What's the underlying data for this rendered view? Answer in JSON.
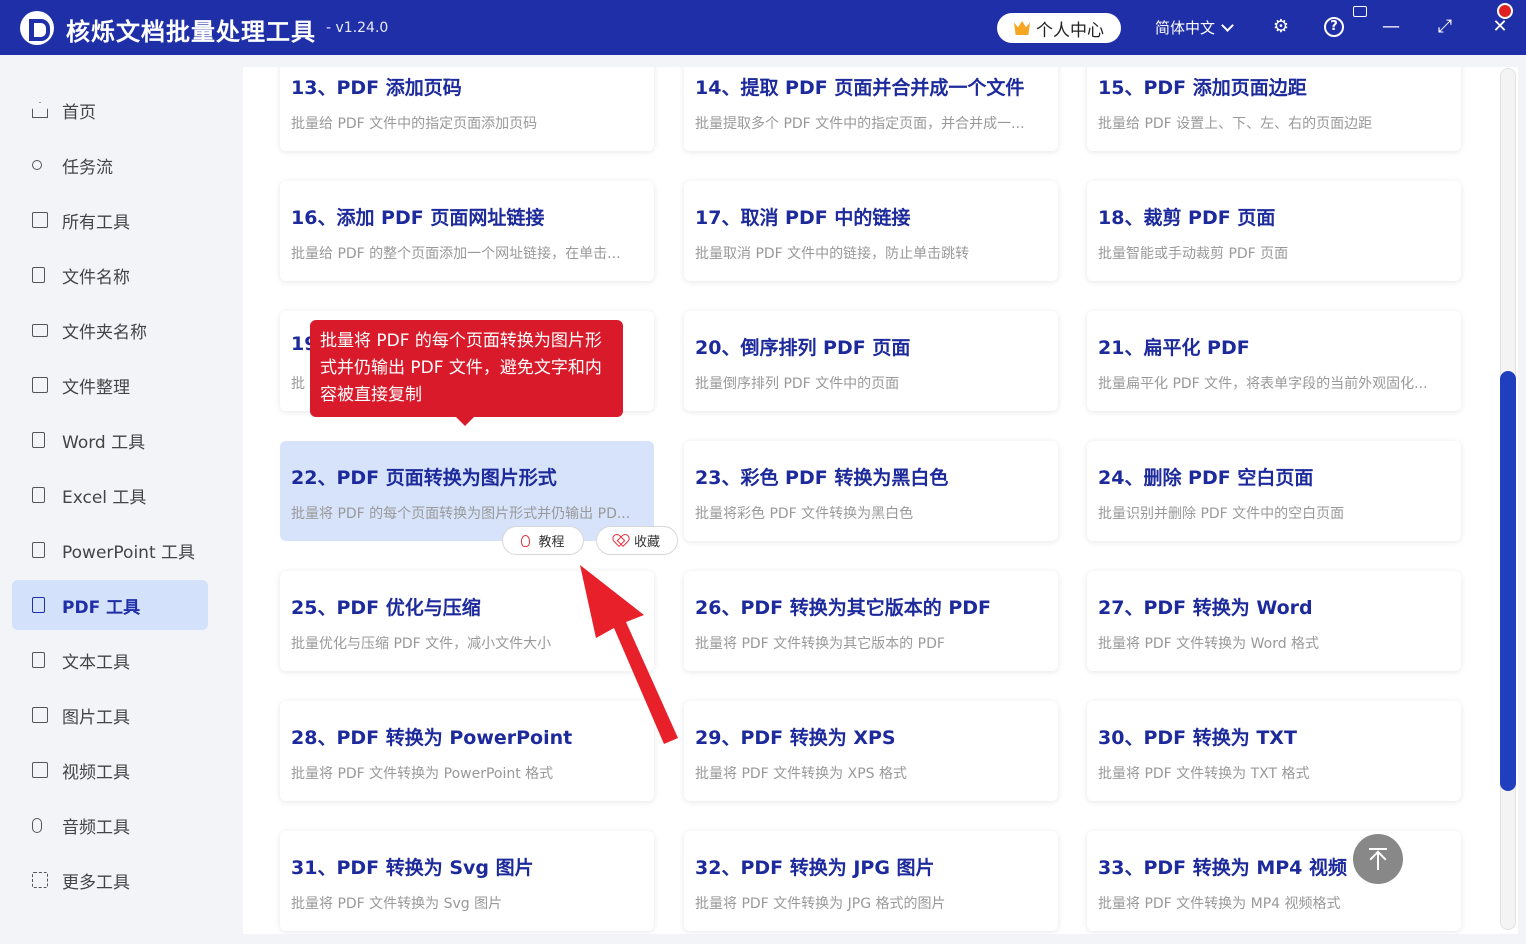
{
  "app": {
    "title": "核烁文档批量处理工具",
    "version": "- v1.24.0",
    "user_center": "个人中心",
    "language": "简体中文",
    "help": "?"
  },
  "sidebar": {
    "items": [
      {
        "label": "首页",
        "icon": "home-icon"
      },
      {
        "label": "任务流",
        "icon": "workflow-icon"
      },
      {
        "label": "所有工具",
        "icon": "monitor-icon"
      },
      {
        "label": "文件名称",
        "icon": "file-copy-icon"
      },
      {
        "label": "文件夹名称",
        "icon": "folder-icon"
      },
      {
        "label": "文件整理",
        "icon": "organize-icon"
      },
      {
        "label": "Word 工具",
        "icon": "word-icon"
      },
      {
        "label": "Excel 工具",
        "icon": "excel-icon"
      },
      {
        "label": "PowerPoint 工具",
        "icon": "powerpoint-icon"
      },
      {
        "label": "PDF 工具",
        "icon": "pdf-icon",
        "active": true
      },
      {
        "label": "文本工具",
        "icon": "text-icon"
      },
      {
        "label": "图片工具",
        "icon": "image-icon"
      },
      {
        "label": "视频工具",
        "icon": "video-icon"
      },
      {
        "label": "音频工具",
        "icon": "audio-icon"
      },
      {
        "label": "更多工具",
        "icon": "grid-icon"
      }
    ]
  },
  "tools": [
    {
      "title": "13、PDF 添加页码",
      "desc": "批量给 PDF 文件中的指定页面添加页码"
    },
    {
      "title": "14、提取 PDF 页面并合并成一个文件",
      "desc": "批量提取多个 PDF 文件中的指定页面，并合并成一..."
    },
    {
      "title": "15、PDF 添加页面边距",
      "desc": "批量给 PDF 设置上、下、左、右的页面边距"
    },
    {
      "title": "16、添加 PDF 页面网址链接",
      "desc": "批量给 PDF 的整个页面添加一个网址链接，在单击..."
    },
    {
      "title": "17、取消 PDF 中的链接",
      "desc": "批量取消 PDF 文件中的链接，防止单击跳转"
    },
    {
      "title": "18、裁剪 PDF 页面",
      "desc": "批量智能或手动裁剪 PDF 页面"
    },
    {
      "title": "19",
      "desc": "批"
    },
    {
      "title": "20、倒序排列 PDF 页面",
      "desc": "批量倒序排列 PDF 文件中的页面"
    },
    {
      "title": "21、扁平化 PDF",
      "desc": "批量扁平化 PDF 文件，将表单字段的当前外观固化..."
    },
    {
      "title": "22、PDF 页面转换为图片形式",
      "desc": "批量将 PDF 的每个页面转换为图片形式并仍输出 PD..."
    },
    {
      "title": "23、彩色 PDF 转换为黑白色",
      "desc": "批量将彩色 PDF 文件转换为黑白色"
    },
    {
      "title": "24、删除 PDF 空白页面",
      "desc": "批量识别并删除 PDF 文件中的空白页面"
    },
    {
      "title": "25、PDF 优化与压缩",
      "desc": "批量优化与压缩 PDF 文件，减小文件大小"
    },
    {
      "title": "26、PDF 转换为其它版本的 PDF",
      "desc": "批量将 PDF 文件转换为其它版本的 PDF"
    },
    {
      "title": "27、PDF 转换为 Word",
      "desc": "批量将 PDF 文件转换为 Word 格式"
    },
    {
      "title": "28、PDF 转换为 PowerPoint",
      "desc": "批量将 PDF 文件转换为 PowerPoint 格式"
    },
    {
      "title": "29、PDF 转换为 XPS",
      "desc": "批量将 PDF 文件转换为 XPS 格式"
    },
    {
      "title": "30、PDF 转换为 TXT",
      "desc": "批量将 PDF 文件转换为 TXT 格式"
    },
    {
      "title": "31、PDF 转换为 Svg 图片",
      "desc": "批量将 PDF 文件转换为 Svg 图片"
    },
    {
      "title": "32、PDF 转换为 JPG 图片",
      "desc": "批量将 PDF 文件转换为 JPG 格式的图片"
    },
    {
      "title": "33、PDF 转换为 MP4 视频",
      "desc": "批量将 PDF 文件转换为 MP4 视频格式"
    }
  ],
  "hover_actions": {
    "tutorial": "教程",
    "favorite": "收藏"
  },
  "tooltip": "批量将 PDF 的每个页面转换为图片形式并仍输出 PDF 文件，避免文字和内容被直接复制",
  "colors": {
    "brand": "#1f2fa8",
    "accent_red": "#d91a2b",
    "active_bg": "#d3e1fb"
  }
}
